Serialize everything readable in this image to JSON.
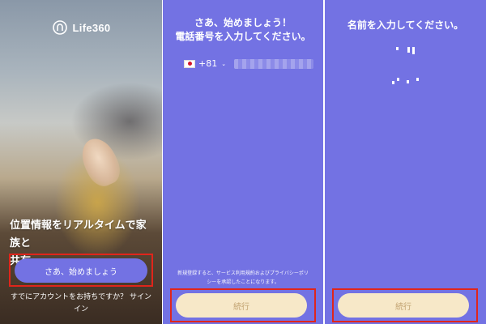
{
  "panel1": {
    "logo_text": "Life360",
    "headline_line1": "位置情報をリアルタイムで家族と",
    "headline_line2": "共有",
    "start_button": "さあ、始めましょう",
    "signin_line1": "すでにアカウントをお持ちですか？ サイン",
    "signin_line2": "イン"
  },
  "panel2": {
    "title_line1": "さあ、始めましょう！",
    "title_line2": "電話番号を入力してください。",
    "country_code": "+81",
    "terms_line1": "新規登録すると、サービス利用規約およびプライバシーポリ",
    "terms_line2": "シーを承認したことになります。",
    "continue_button": "続行"
  },
  "panel3": {
    "title": "名前を入力してください。",
    "continue_button": "続行"
  },
  "colors": {
    "brand_purple": "#7372e3",
    "button_cream": "#f7e8c8",
    "highlight_red": "#e0251b"
  }
}
